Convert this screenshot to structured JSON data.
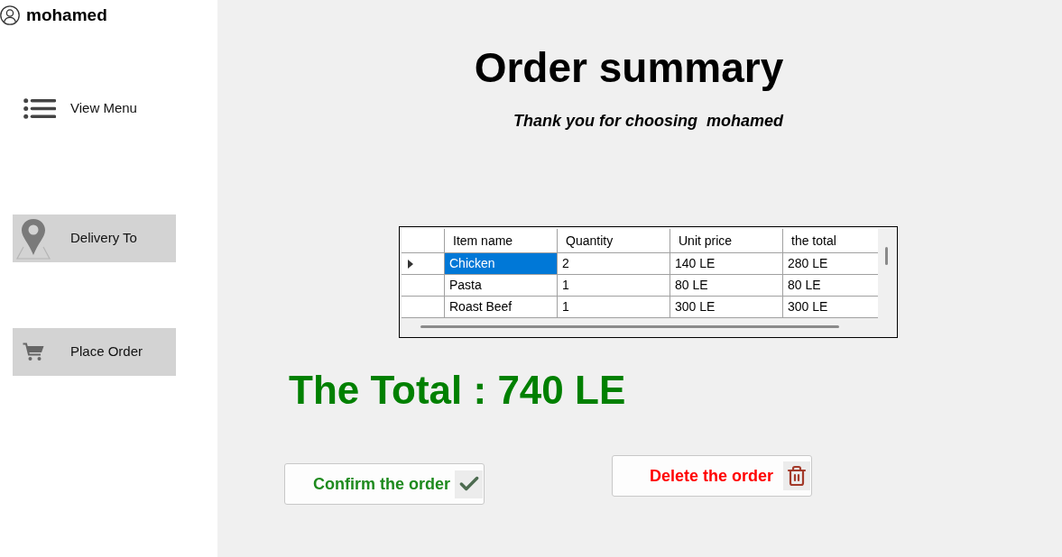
{
  "sidebar": {
    "user": {
      "name": "mohamed"
    },
    "items": [
      {
        "label": "View Menu",
        "kind": "plain"
      },
      {
        "label": "Delivery To",
        "kind": "tile"
      },
      {
        "label": "Place Order",
        "kind": "tile"
      }
    ]
  },
  "main": {
    "title": "Order summary",
    "subtitle": "Thank you for choosing  mohamed",
    "table": {
      "columns": [
        "Item name",
        "Quantity",
        "Unit price",
        "the total"
      ],
      "rows": [
        {
          "current": true,
          "cells": [
            {
              "text": "Chicken",
              "selected": true
            },
            {
              "text": "2",
              "selected": false
            },
            {
              "text": "140 LE",
              "selected": false
            },
            {
              "text": "280 LE",
              "selected": false
            }
          ]
        },
        {
          "current": false,
          "cells": [
            {
              "text": "Pasta",
              "selected": false
            },
            {
              "text": "1",
              "selected": false
            },
            {
              "text": "80 LE",
              "selected": false
            },
            {
              "text": "80 LE",
              "selected": false
            }
          ]
        },
        {
          "current": false,
          "cells": [
            {
              "text": "Roast Beef",
              "selected": false
            },
            {
              "text": "1",
              "selected": false
            },
            {
              "text": "300 LE",
              "selected": false
            },
            {
              "text": "300 LE",
              "selected": false
            }
          ]
        }
      ]
    },
    "total": "The Total : 740 LE",
    "buttons": [
      {
        "label": "Confirm the order",
        "kind": "confirm"
      },
      {
        "label": "Delete the order",
        "kind": "delete"
      }
    ]
  }
}
